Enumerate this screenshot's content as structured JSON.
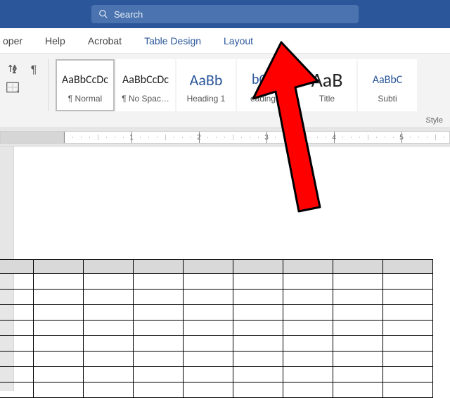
{
  "titlebar": {
    "search_placeholder": "Search"
  },
  "tabs": {
    "developer": "oper",
    "help": "Help",
    "acrobat": "Acrobat",
    "table_design": "Table Design",
    "layout": "Layout"
  },
  "ribbon": {
    "group_label": "Style",
    "styles": [
      {
        "preview": "AaBbCcDc",
        "name": "¶ Normal",
        "size": 16,
        "heading": false
      },
      {
        "preview": "AaBbCcDc",
        "name": "¶ No Spac…",
        "size": 16,
        "heading": false
      },
      {
        "preview": "AaBb",
        "name": "Heading 1",
        "size": 22,
        "heading": true
      },
      {
        "preview": "bCcD",
        "name": "eading 2",
        "size": 20,
        "heading": true
      },
      {
        "preview": "AaB",
        "name": "Title",
        "size": 28,
        "heading": false
      },
      {
        "preview": "AaBbC",
        "name": "Subti",
        "size": 16,
        "heading": true
      }
    ]
  },
  "ruler": {
    "numbers": [
      1,
      2,
      3,
      4,
      5
    ]
  },
  "table": {
    "cols": 9,
    "body_rows": 8
  },
  "annotation": {
    "points_to": "layout-tab",
    "color": "#ff0000"
  }
}
